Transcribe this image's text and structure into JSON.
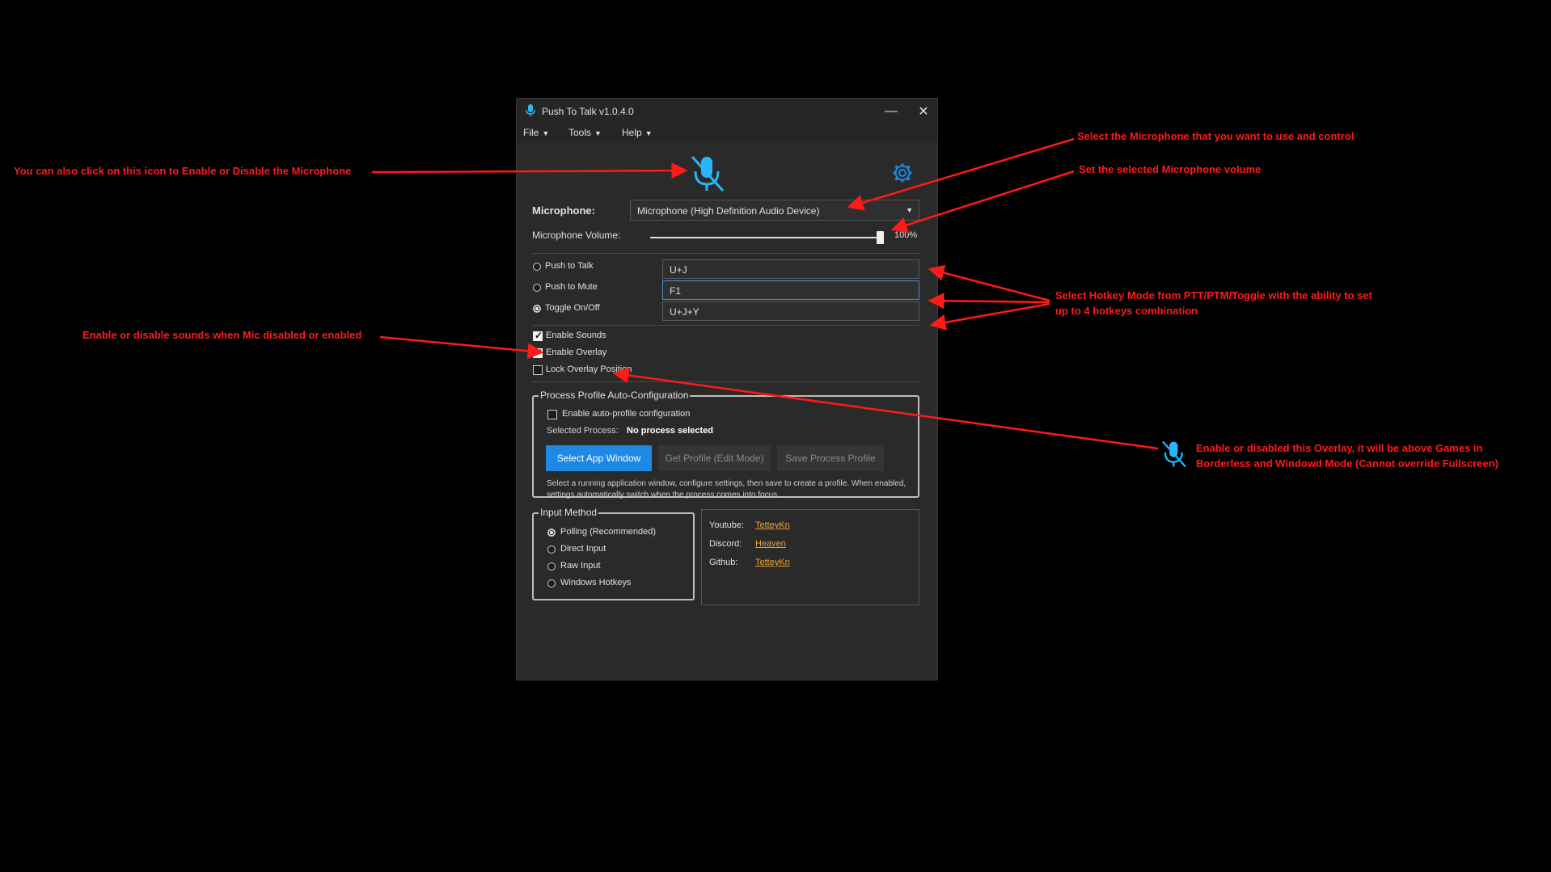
{
  "window": {
    "title": "Push To Talk v1.0.4.0",
    "menu": [
      "File",
      "Tools",
      "Help"
    ]
  },
  "microphone": {
    "label": "Microphone:",
    "selected": "Microphone (High Definition Audio Device)",
    "volume_label": "Microphone Volume:",
    "volume_value": "100%",
    "volume_level": 1.0
  },
  "modes": [
    {
      "label": "Push to Talk",
      "hotkey": "U+J",
      "selected": false
    },
    {
      "label": "Push to Mute",
      "hotkey": "F1",
      "selected": false
    },
    {
      "label": "Toggle On/Off",
      "hotkey": "U+J+Y",
      "selected": true
    }
  ],
  "options": [
    {
      "label": "Enable Sounds",
      "checked": true
    },
    {
      "label": "Enable Overlay",
      "checked": true
    },
    {
      "label": "Lock Overlay Position",
      "checked": false
    }
  ],
  "profile": {
    "legend": "Process Profile Auto-Configuration",
    "enable_label": "Enable auto-profile configuration",
    "selected_process_label": "Selected Process:",
    "selected_process_value": "No process selected",
    "btn_select": "Select App Window",
    "btn_get": "Get Profile (Edit Mode)",
    "btn_save": "Save Process Profile",
    "help": "Select a running application window, configure settings, then save to create a profile. When enabled, settings automatically switch when the process comes into focus."
  },
  "input_method": {
    "legend": "Input Method",
    "options": [
      {
        "label": "Polling (Recommended)",
        "selected": true
      },
      {
        "label": "Direct Input",
        "selected": false
      },
      {
        "label": "Raw Input",
        "selected": false
      },
      {
        "label": "Windows Hotkeys",
        "selected": false
      }
    ]
  },
  "links": [
    {
      "label": "Youtube:",
      "value": "TetteyKn"
    },
    {
      "label": "Discord:",
      "value": "Heaven"
    },
    {
      "label": "Github:",
      "value": "TetteyKn"
    }
  ],
  "annotations": {
    "mic_icon": "You can also click on this icon to Enable or Disable the Microphone",
    "select_mic": "Select the Microphone that you want to use and control",
    "volume": "Set the selected Microphone volume",
    "hotkey_line1": "Select Hotkey Mode from PTT/PTM/Toggle with the ability to set",
    "hotkey_line2": "up to 4 hotkeys combination",
    "sounds": "Enable or disable sounds when Mic disabled or enabled",
    "overlay_line1": "Enable or disabled this Overlay, it will be above Games in",
    "overlay_line2": "Borderless and Windowd Mode (Cannot override Fullscreen)"
  },
  "colors": {
    "accent": "#1e88e5",
    "icon_blue": "#29b6f6",
    "annotation": "#ff1a1a",
    "link": "#f0a030"
  }
}
